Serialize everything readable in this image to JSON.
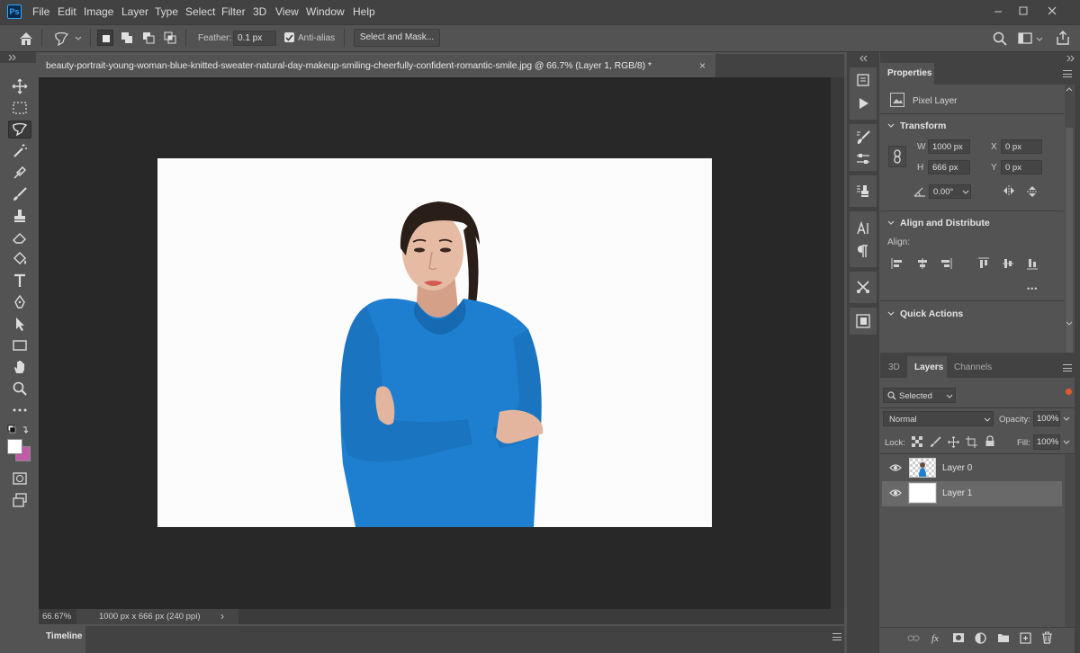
{
  "app": {
    "logo": "Ps"
  },
  "menu": [
    "File",
    "Edit",
    "Image",
    "Layer",
    "Type",
    "Select",
    "Filter",
    "3D",
    "View",
    "Window",
    "Help"
  ],
  "options": {
    "feather_label": "Feather:",
    "feather_value": "0.1 px",
    "anti_alias_label": "Anti-alias",
    "anti_alias_checked": true,
    "select_mask_label": "Select and Mask..."
  },
  "document": {
    "tab_title": "beauty-portrait-young-woman-blue-knitted-sweater-natural-day-makeup-smiling-cheerfully-confident-romantic-smile.jpg @ 66.7% (Layer 1, RGB/8) *",
    "close": "×",
    "zoom": "66.67%",
    "info": "1000 px x 666 px (240 ppi)",
    "info_arrow": "›"
  },
  "timeline": {
    "label": "Timeline"
  },
  "properties": {
    "tab": "Properties",
    "layer_type": "Pixel Layer",
    "transform": {
      "title": "Transform",
      "w_label": "W",
      "w_value": "1000 px",
      "h_label": "H",
      "h_value": "666 px",
      "x_label": "X",
      "x_value": "0 px",
      "y_label": "Y",
      "y_value": "0 px",
      "angle_value": "0.00°"
    },
    "align": {
      "title": "Align and Distribute",
      "label": "Align:",
      "more": "•••"
    },
    "quick_actions": {
      "title": "Quick Actions"
    }
  },
  "layers_panel": {
    "tabs": [
      "3D",
      "Layers",
      "Channels"
    ],
    "active_tab": "Layers",
    "filter": "Selected",
    "blend_mode": "Normal",
    "opacity_label": "Opacity:",
    "opacity_value": "100%",
    "lock_label": "Lock:",
    "fill_label": "Fill:",
    "fill_value": "100%",
    "layers": [
      {
        "name": "Layer 0",
        "selected": false
      },
      {
        "name": "Layer 1",
        "selected": true
      }
    ]
  },
  "colors": {
    "accent": "#31a8ff",
    "foreground": "#ffffff",
    "background": "#c25aa8",
    "sweater": "#1e7fd0"
  }
}
